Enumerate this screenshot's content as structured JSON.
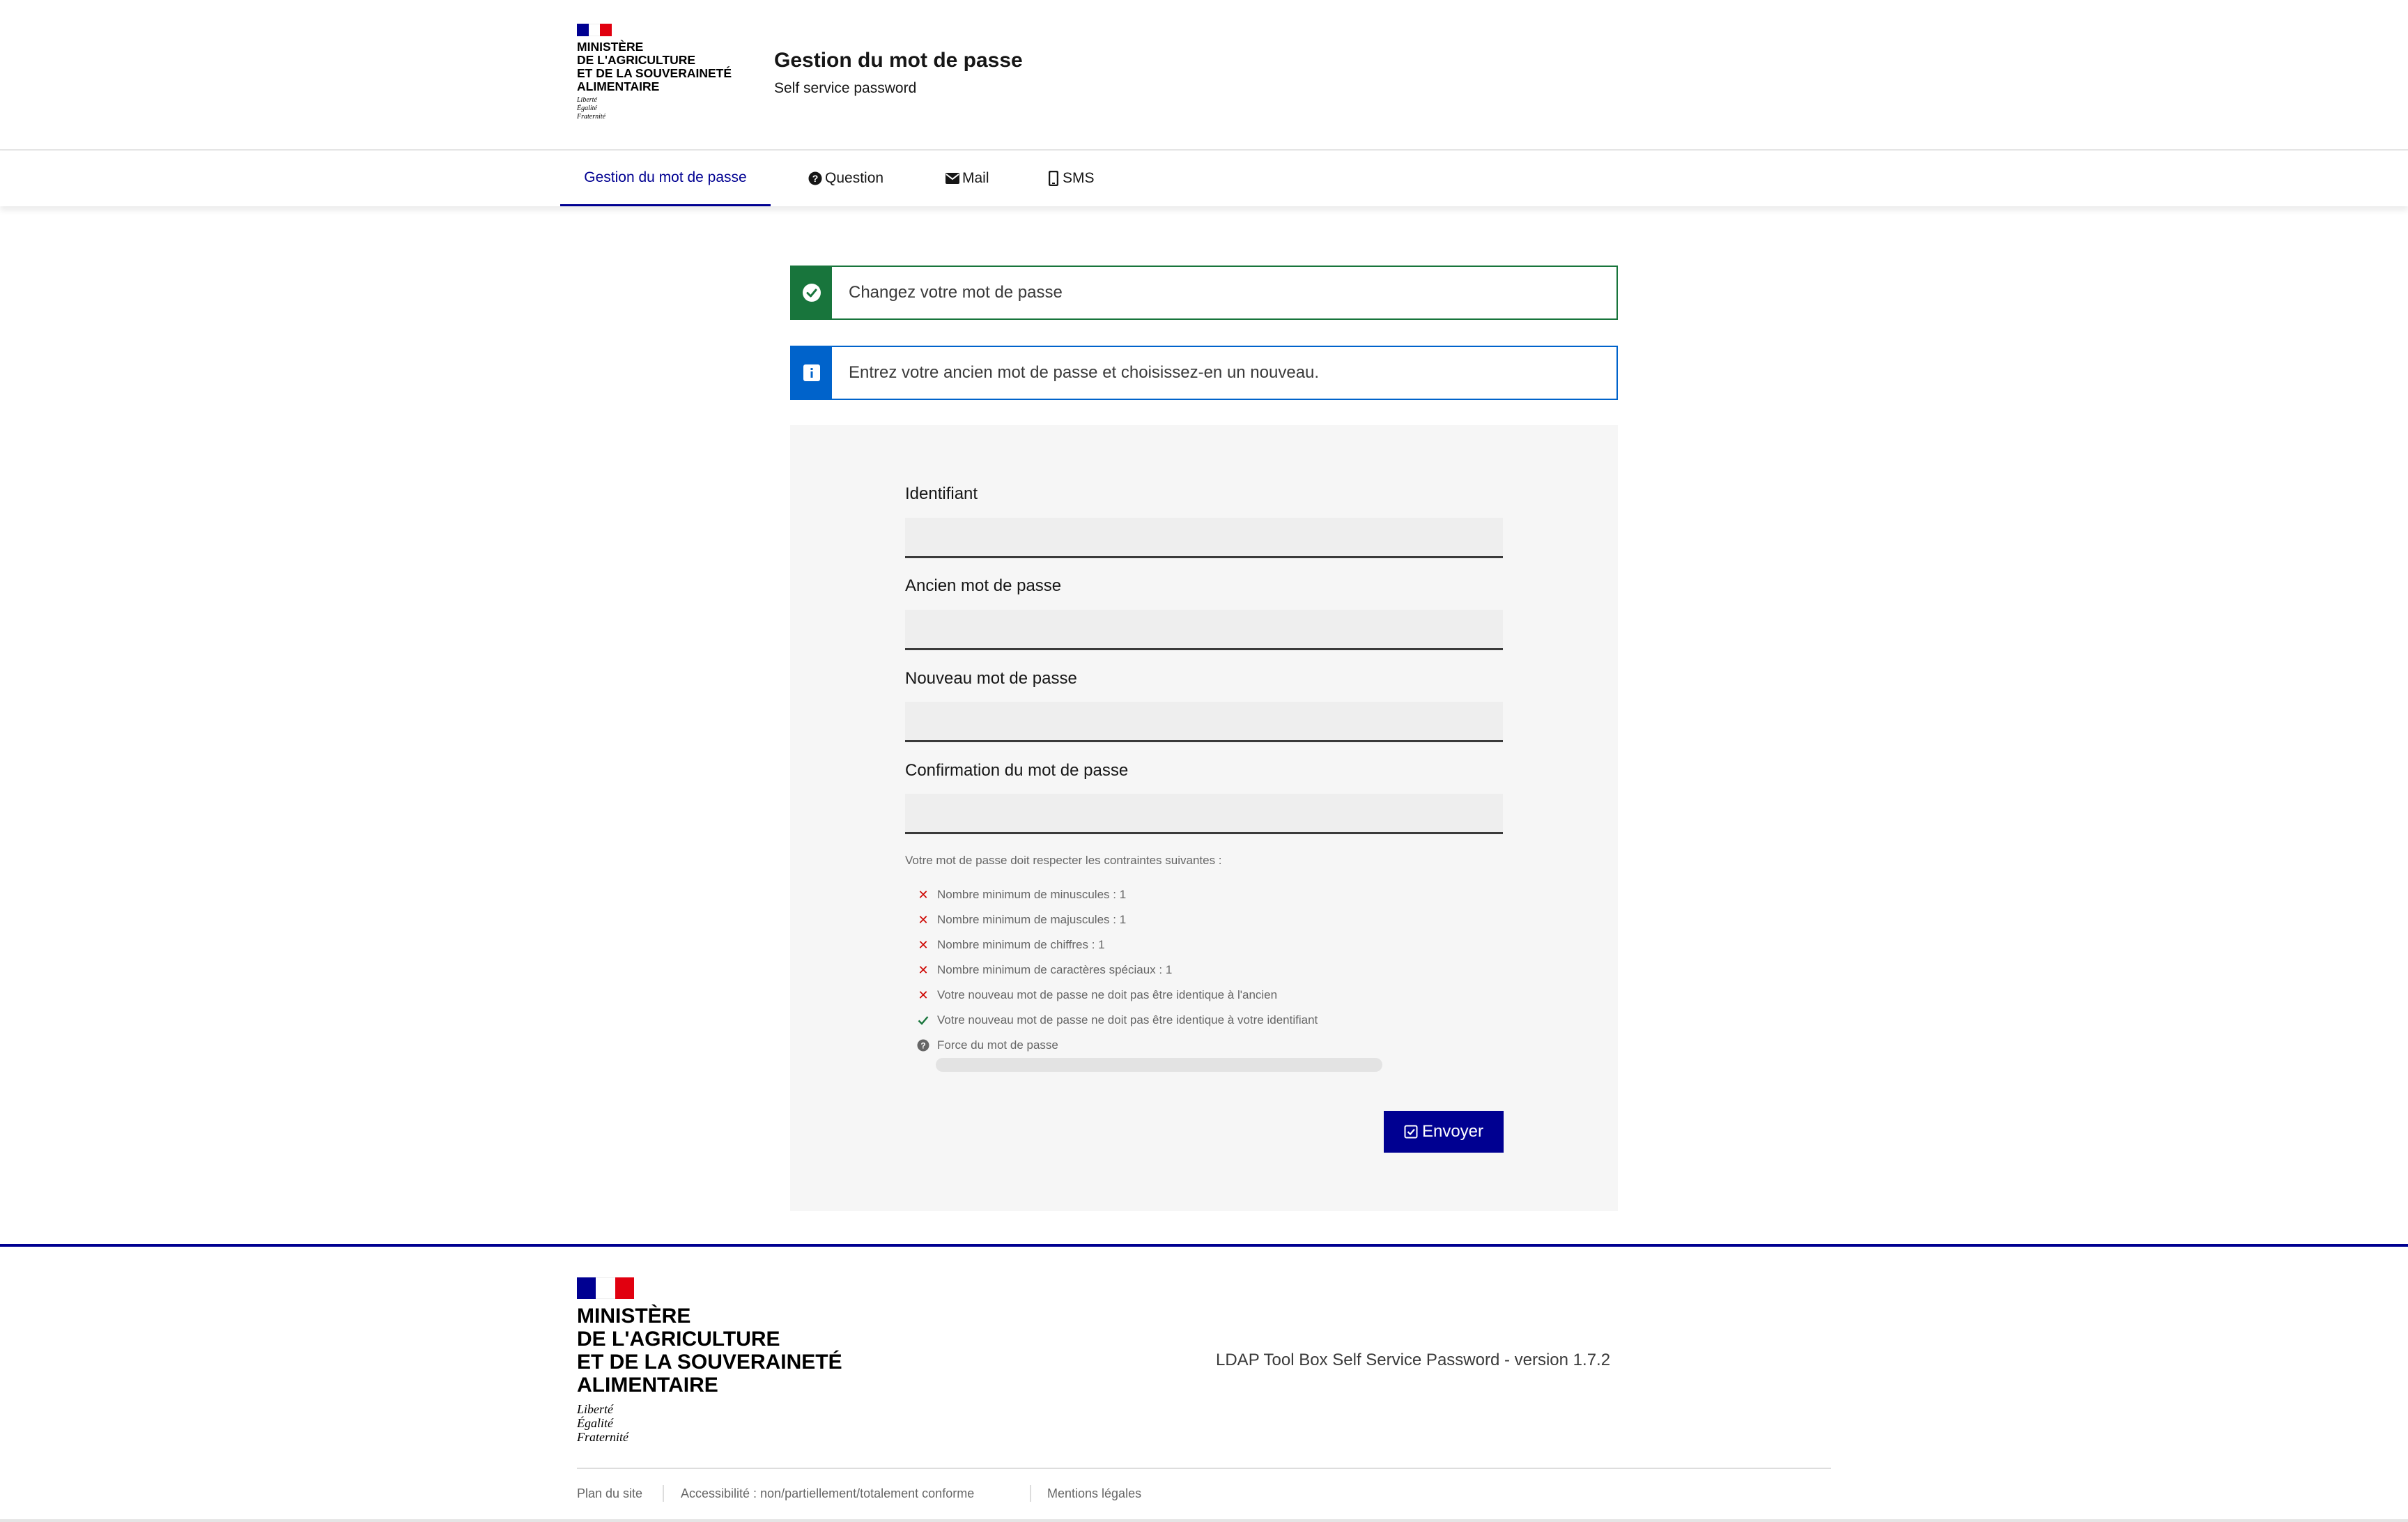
{
  "header": {
    "ministry_lines": [
      "Ministère",
      "de l'Agriculture",
      "et de la Souveraineté",
      "Alimentaire"
    ],
    "motto_lines": [
      "Liberté",
      "Égalité",
      "Fraternité"
    ],
    "title": "Gestion du mot de passe",
    "tagline": "Self service password"
  },
  "colors": {
    "primary": "#000091",
    "success": "#18753c",
    "info": "#0063cb",
    "error": "#ce0500",
    "flag_blue": "#000091",
    "flag_white": "#ffffff",
    "flag_red": "#e1000f"
  },
  "nav": {
    "items": [
      {
        "label": "Gestion du mot de passe",
        "icon": "",
        "active": true
      },
      {
        "label": "Question",
        "icon": "question-circle-icon",
        "active": false
      },
      {
        "label": "Mail",
        "icon": "envelope-icon",
        "active": false
      },
      {
        "label": "SMS",
        "icon": "mobile-phone-icon",
        "active": false
      }
    ]
  },
  "alerts": {
    "success": {
      "text": "Changez votre mot de passe",
      "icon": "check-circle-icon"
    },
    "info": {
      "text": "Entrez votre ancien mot de passe et choisissez-en un nouveau.",
      "icon": "info-icon"
    }
  },
  "form": {
    "fields": [
      {
        "label": "Identifiant",
        "value": "",
        "placeholder": ""
      },
      {
        "label": "Ancien mot de passe",
        "value": "",
        "placeholder": ""
      },
      {
        "label": "Nouveau mot de passe",
        "value": "",
        "placeholder": ""
      },
      {
        "label": "Confirmation du mot de passe",
        "value": "",
        "placeholder": ""
      }
    ],
    "rules_intro": "Votre mot de passe doit respecter les contraintes suivantes :",
    "rules": [
      {
        "text": "Nombre minimum de minuscules : 1",
        "status": "ko",
        "icon": "cross-icon"
      },
      {
        "text": "Nombre minimum de majuscules : 1",
        "status": "ko",
        "icon": "cross-icon"
      },
      {
        "text": "Nombre minimum de chiffres : 1",
        "status": "ko",
        "icon": "cross-icon"
      },
      {
        "text": "Nombre minimum de caractères spéciaux : 1",
        "status": "ko",
        "icon": "cross-icon"
      },
      {
        "text": "Votre nouveau mot de passe ne doit pas être identique à l'ancien",
        "status": "ko",
        "icon": "cross-icon"
      },
      {
        "text": "Votre nouveau mot de passe ne doit pas être identique à votre identifiant",
        "status": "ok",
        "icon": "check-icon"
      },
      {
        "text": "Force du mot de passe",
        "status": "info",
        "icon": "question-circle-icon"
      }
    ],
    "strength_fraction": 0,
    "submit_label": "Envoyer",
    "submit_icon": "check-square-icon"
  },
  "footer": {
    "ministry_lines": [
      "Ministère",
      "de l'Agriculture",
      "et de la Souveraineté",
      "Alimentaire"
    ],
    "motto_lines": [
      "Liberté",
      "Égalité",
      "Fraternité"
    ],
    "version": "LDAP Tool Box Self Service Password - version 1.7.2",
    "links": [
      "Plan du site",
      "Accessibilité : non/partiellement/totalement conforme",
      "Mentions légales"
    ]
  }
}
